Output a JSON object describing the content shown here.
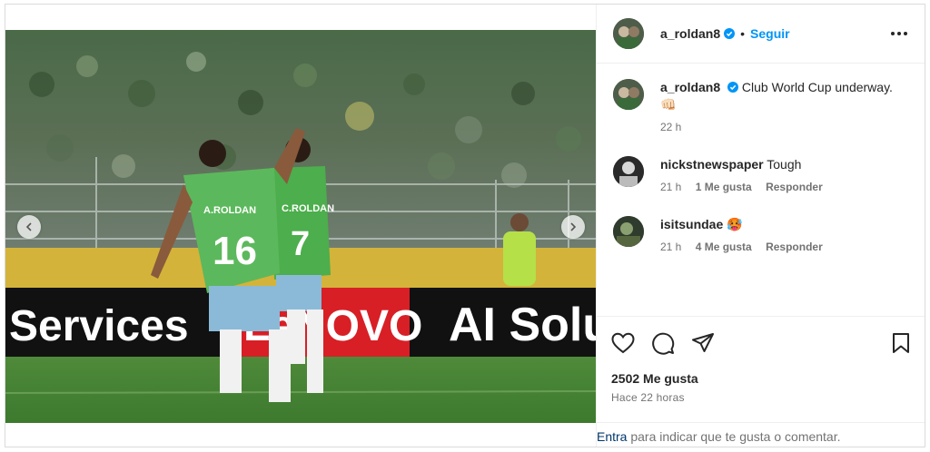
{
  "post": {
    "username": "a_roldan8",
    "dot": "•",
    "follow_label": "Seguir",
    "caption_text": "Club World Cup underway.",
    "caption_emoji": "👊🏻",
    "caption_time": "22 h"
  },
  "photo": {
    "banner_left": "Services",
    "banner_mid": "LeNOVO",
    "banner_right": "AI Solu",
    "player1_name": "A.ROLDAN",
    "player1_number": "16",
    "player2_name": "C.ROLDAN",
    "player2_number": "7"
  },
  "comments": [
    {
      "user": "nickstnewspaper",
      "text": "Tough",
      "time": "21 h",
      "likes": "1 Me gusta",
      "reply": "Responder"
    },
    {
      "user": "isitsundae",
      "text": "🥵",
      "time": "21 h",
      "likes": "4 Me gusta",
      "reply": "Responder"
    }
  ],
  "stats": {
    "likes": "2502 Me gusta",
    "ago": "Hace 22 horas"
  },
  "login": {
    "link": "Entra",
    "text": " para indicar que te gusta o comentar."
  },
  "icons": {
    "prev": "chevron-left-icon",
    "next": "chevron-right-icon",
    "more": "more-options-icon",
    "like": "heart-icon",
    "comment": "comment-icon",
    "share": "share-icon",
    "save": "bookmark-icon",
    "verified": "verified-badge-icon"
  },
  "colors": {
    "accent": "#0095f6",
    "verified": "#0095f6",
    "muted": "#737373",
    "link": "#00376b",
    "jersey": "#5cb85c"
  }
}
